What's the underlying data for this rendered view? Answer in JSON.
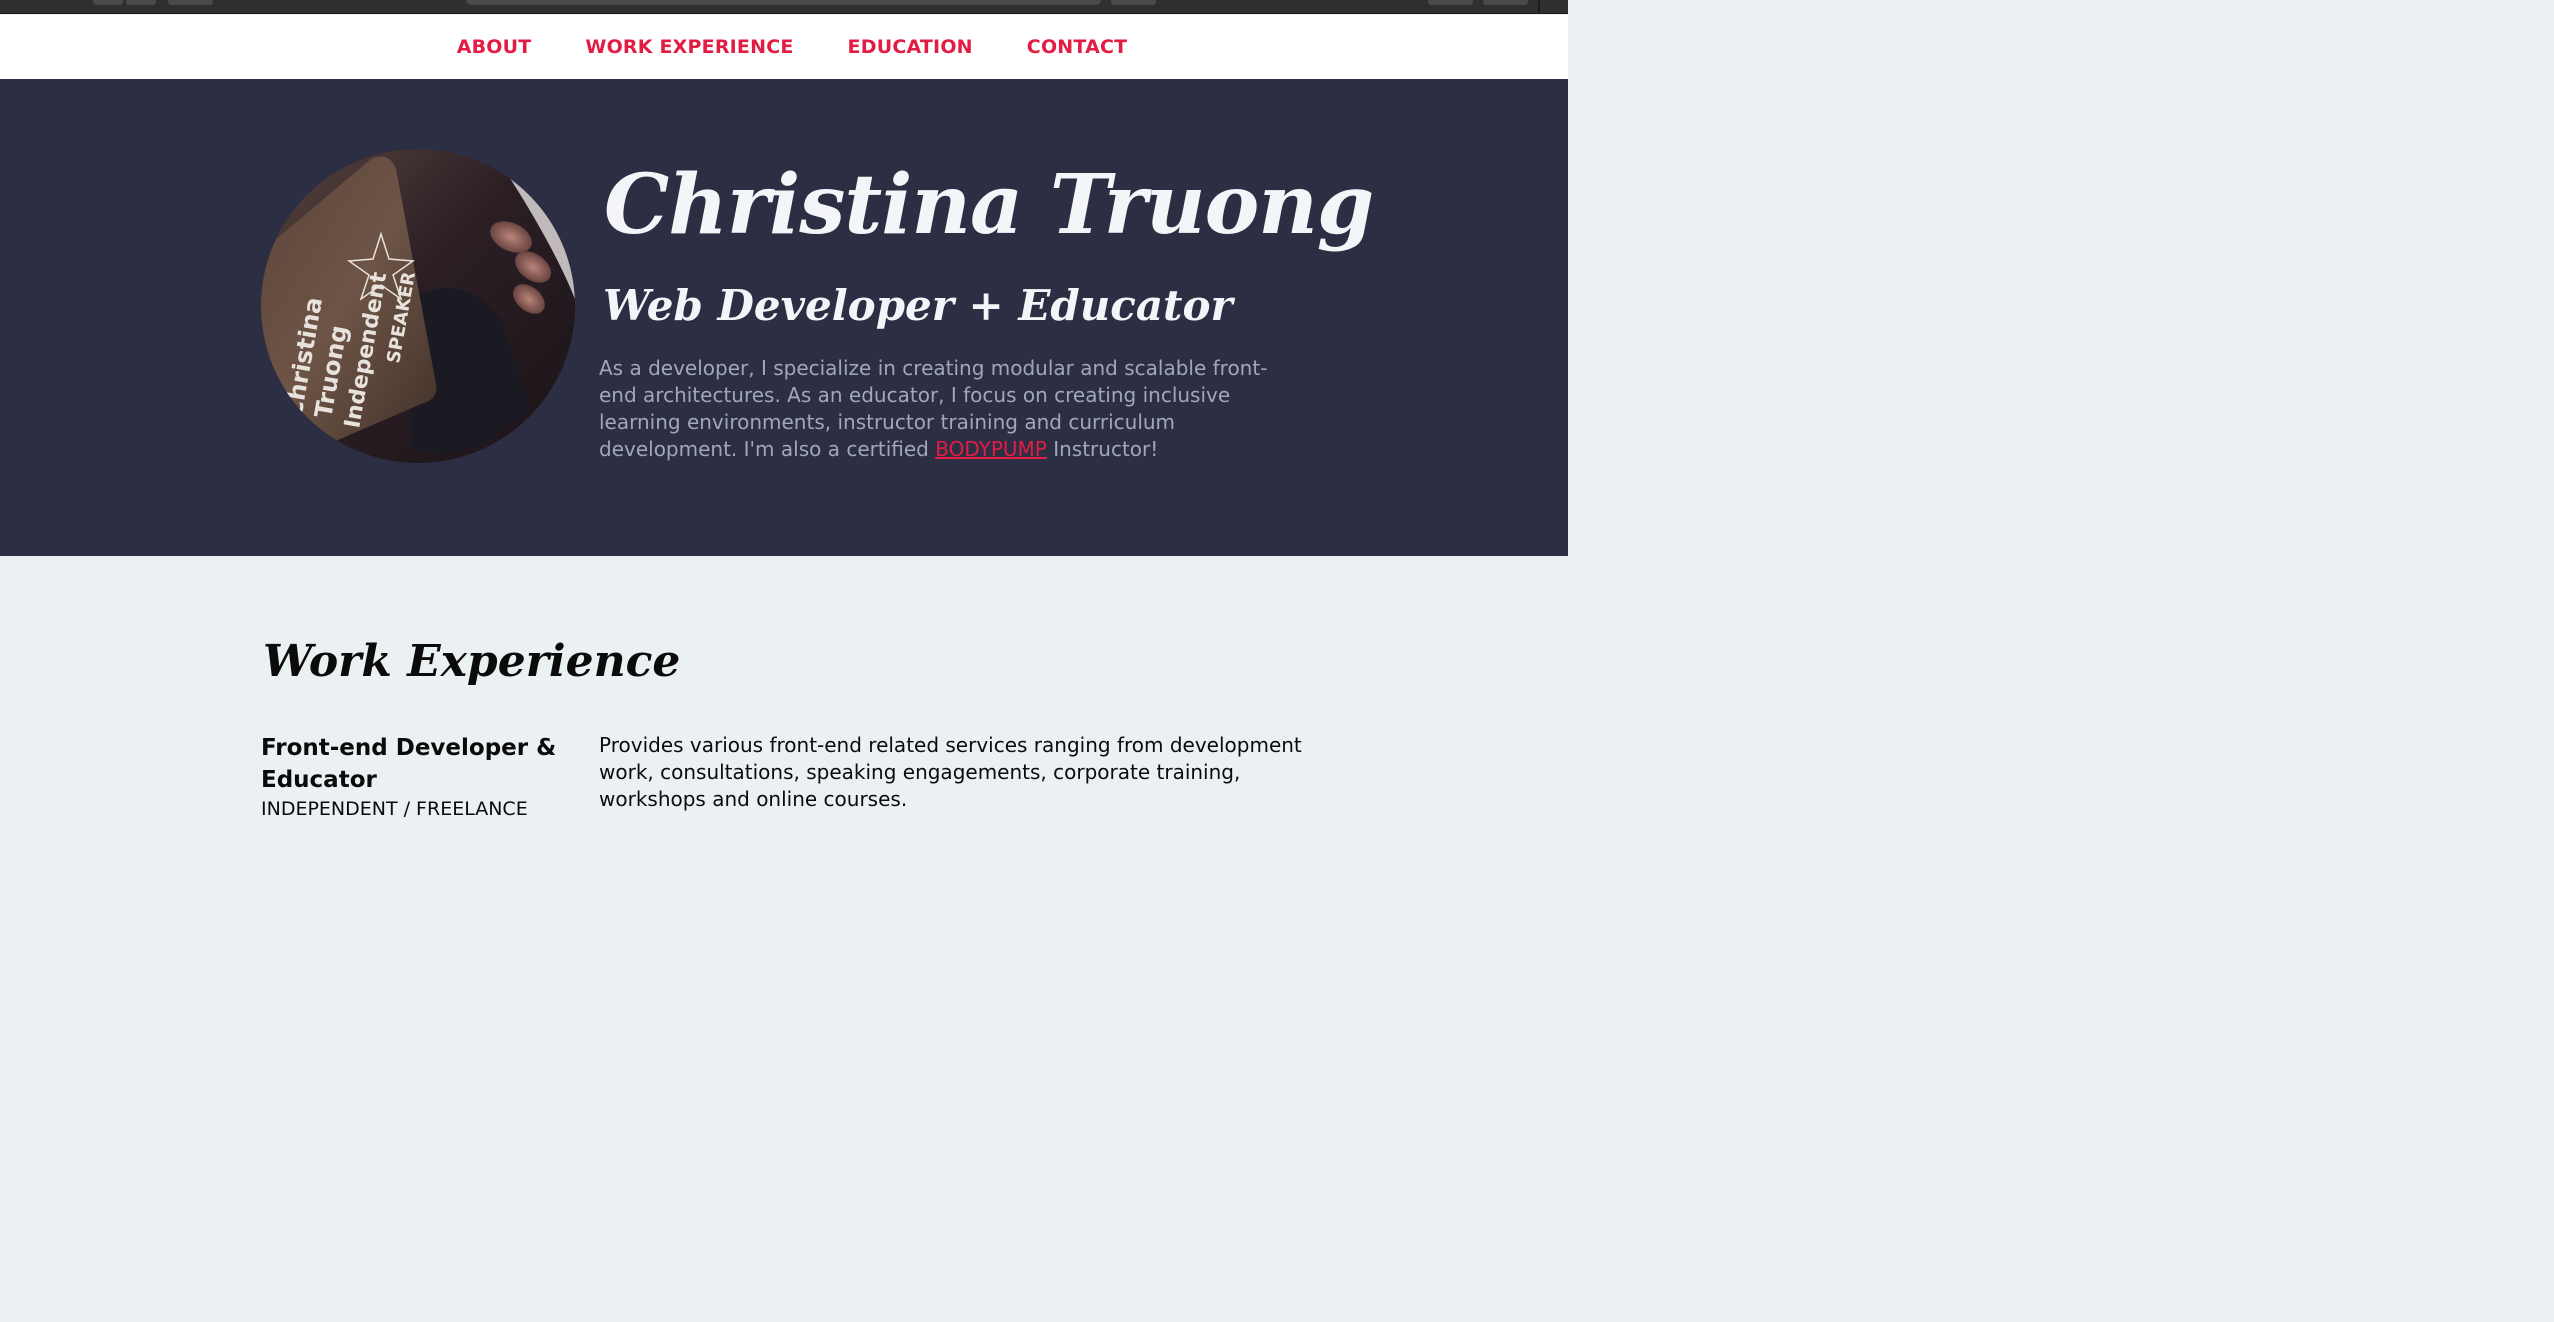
{
  "nav": {
    "items": [
      {
        "label": "ABOUT"
      },
      {
        "label": "WORK EXPERIENCE"
      },
      {
        "label": "EDUCATION"
      },
      {
        "label": "CONTACT"
      }
    ]
  },
  "hero": {
    "name": "Christina Truong",
    "title": "Web Developer + Educator",
    "bio_before_link": "As a developer, I specialize in creating modular and scalable front-end architectures. As an educator, I focus on creating inclusive learning environments, instructor training and curriculum development. I'm also a certified ",
    "bio_link": "BODYPUMP",
    "bio_after_link": " Instructor!",
    "avatar_badge_lines": [
      "Christina",
      "Truong",
      "Independent",
      "SPEAKER"
    ]
  },
  "work": {
    "heading": "Work Experience",
    "jobs": [
      {
        "title": "Front-end Developer & Educator",
        "company": "INDEPENDENT / FREELANCE",
        "description": "Provides various front-end related services ranging from development work, consultations, speaking engagements, corporate training, workshops and online courses."
      }
    ]
  },
  "colors": {
    "accent": "#e31c44",
    "hero_bg": "#2c2e43",
    "section_bg": "#ebf0f3"
  }
}
